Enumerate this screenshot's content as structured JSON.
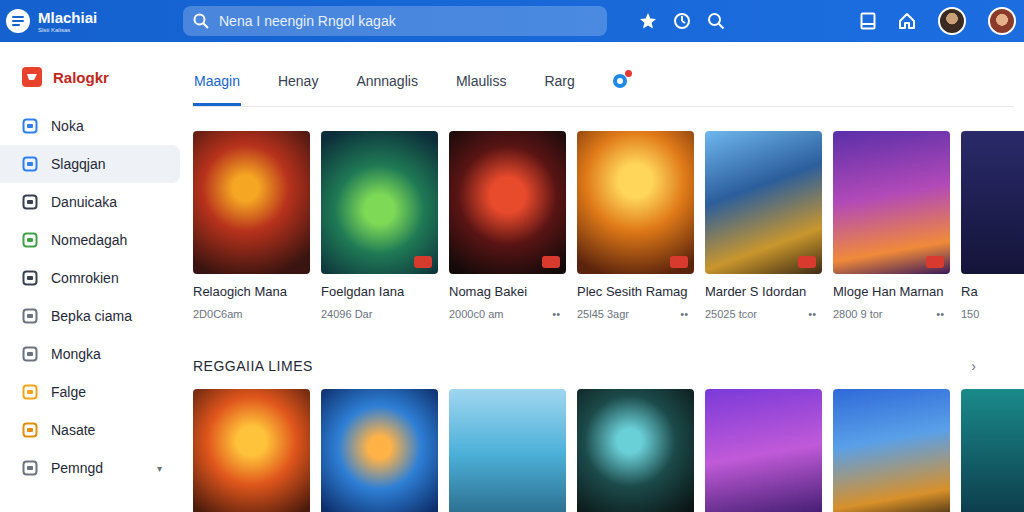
{
  "app": {
    "name": "Mlachiai",
    "tagline": "Slsti Kalisas"
  },
  "search": {
    "placeholder": "Nena I neengin Rngol kagak"
  },
  "sidebar": {
    "title": "Ralogkr",
    "items": [
      {
        "label": "Noka",
        "selected": false
      },
      {
        "label": "Slagqjan",
        "selected": true
      },
      {
        "label": "Danuicaka",
        "selected": false
      },
      {
        "label": "Nomedagah",
        "selected": false
      },
      {
        "label": "Comrokien",
        "selected": false
      },
      {
        "label": "Bepka ciama",
        "selected": false
      },
      {
        "label": "Mongka",
        "selected": false
      },
      {
        "label": "Falge",
        "selected": false
      },
      {
        "label": "Nasate",
        "selected": false
      },
      {
        "label": "Pemngd",
        "selected": false,
        "caret": "▾"
      }
    ]
  },
  "tabs": [
    {
      "label": "Maagin",
      "selected": true
    },
    {
      "label": "Henay",
      "selected": false
    },
    {
      "label": "Annnaglis",
      "selected": false
    },
    {
      "label": "Mlauliss",
      "selected": false
    },
    {
      "label": "Rarg",
      "selected": false
    }
  ],
  "tab_alert": {
    "dot": true
  },
  "featured": [
    {
      "title": "Relaogich Mana",
      "sub": "2D0C6am",
      "badge": false
    },
    {
      "title": "Foelgdan Iana",
      "sub": "24096 Dar",
      "badge": true
    },
    {
      "title": "Nomag Bakei",
      "sub": "2000c0 am",
      "more": "••",
      "badge": true
    },
    {
      "title": "Plec Sesith Ramag",
      "sub": "25l45 3agr",
      "more": "••",
      "badge": true
    },
    {
      "title": "Marder S Idordan",
      "sub": "25025 tcor",
      "more": "••",
      "badge": true
    },
    {
      "title": "Mloge Han Marnan",
      "sub": "2800 9 tor",
      "more": "••",
      "badge": true
    },
    {
      "title": "Ra",
      "sub": "150",
      "badge": false
    }
  ],
  "section": {
    "title": "REGGAIIA LIMES",
    "more": "›",
    "cards": [
      {
        "badge": false
      },
      {
        "badge": false
      },
      {
        "badge": false
      },
      {
        "badge": false
      },
      {
        "badge": false
      },
      {
        "badge": false
      },
      {
        "badge": false
      }
    ]
  }
}
